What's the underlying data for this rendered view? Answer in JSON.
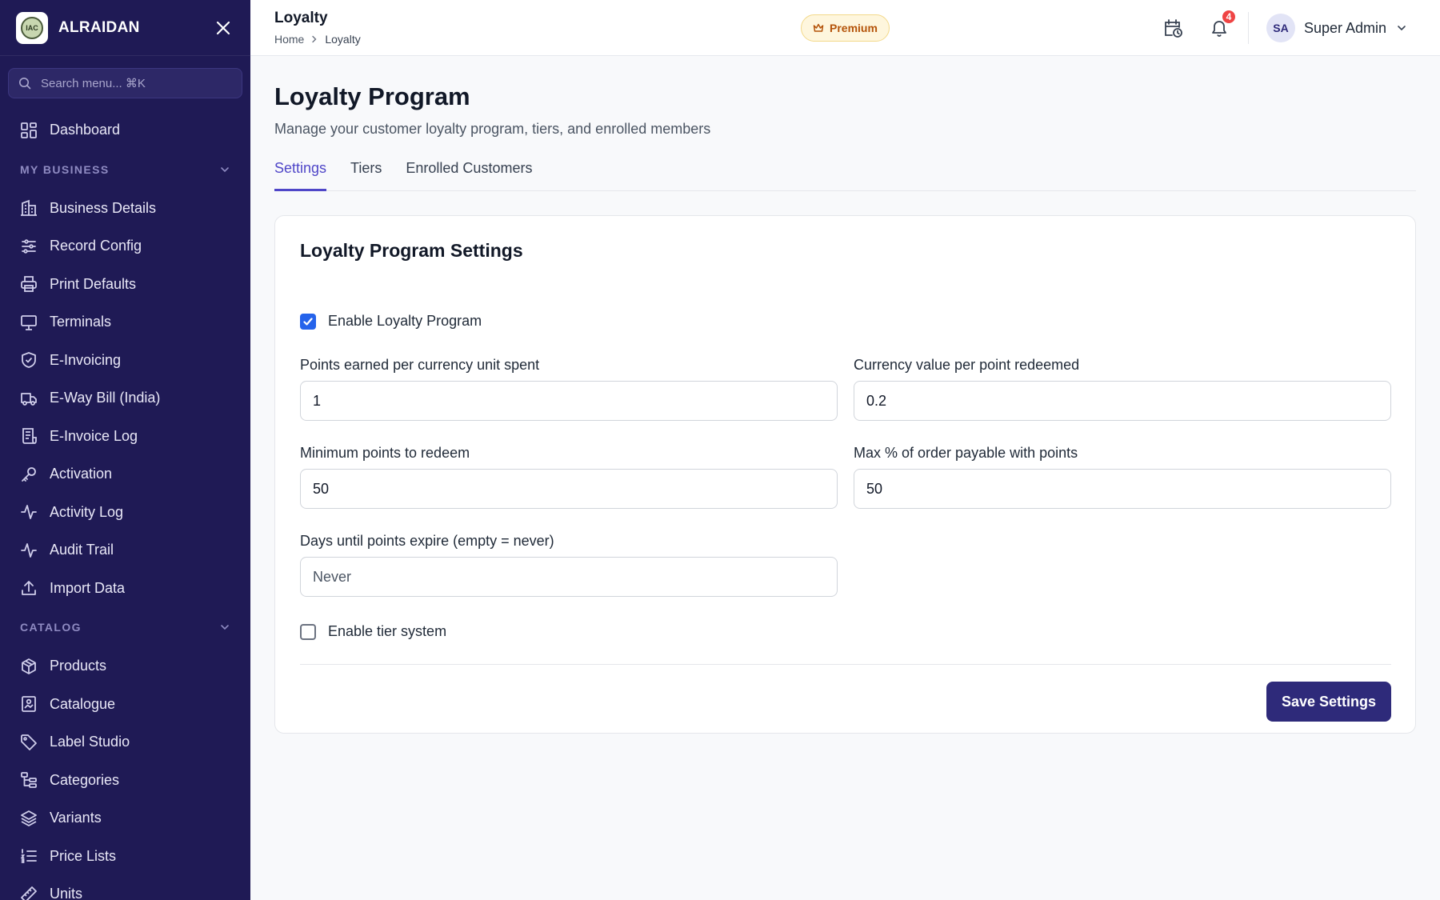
{
  "brand": {
    "name": "ALRAIDAN",
    "logo_text": "IAC"
  },
  "sidebar": {
    "search_placeholder": "Search menu... ⌘K",
    "top_items": [
      {
        "label": "Dashboard",
        "icon": "dashboard-icon"
      }
    ],
    "sections": [
      {
        "title": "MY BUSINESS",
        "items": [
          {
            "label": "Business Details",
            "icon": "building-icon"
          },
          {
            "label": "Record Config",
            "icon": "sliders-icon"
          },
          {
            "label": "Print Defaults",
            "icon": "printer-icon"
          },
          {
            "label": "Terminals",
            "icon": "monitor-icon"
          },
          {
            "label": "E-Invoicing",
            "icon": "shield-check-icon"
          },
          {
            "label": "E-Way Bill (India)",
            "icon": "truck-icon"
          },
          {
            "label": "E-Invoice Log",
            "icon": "receipt-icon"
          },
          {
            "label": "Activation",
            "icon": "key-icon"
          },
          {
            "label": "Activity Log",
            "icon": "activity-icon"
          },
          {
            "label": "Audit Trail",
            "icon": "activity-icon"
          },
          {
            "label": "Import Data",
            "icon": "upload-icon"
          }
        ]
      },
      {
        "title": "CATALOG",
        "items": [
          {
            "label": "Products",
            "icon": "package-icon"
          },
          {
            "label": "Catalogue",
            "icon": "image-book-icon"
          },
          {
            "label": "Label Studio",
            "icon": "tag-icon"
          },
          {
            "label": "Categories",
            "icon": "tree-icon"
          },
          {
            "label": "Variants",
            "icon": "layers-icon"
          },
          {
            "label": "Price Lists",
            "icon": "list-ordered-icon"
          },
          {
            "label": "Units",
            "icon": "ruler-icon"
          }
        ]
      }
    ]
  },
  "header": {
    "title": "Loyalty",
    "breadcrumb": [
      "Home",
      "Loyalty"
    ],
    "premium_label": "Premium",
    "notification_count": "4",
    "user": {
      "initials": "SA",
      "name": "Super Admin"
    }
  },
  "page": {
    "title": "Loyalty Program",
    "subtitle": "Manage your customer loyalty program, tiers, and enrolled members",
    "tabs": [
      "Settings",
      "Tiers",
      "Enrolled Customers"
    ],
    "active_tab": "Settings"
  },
  "settings": {
    "card_title": "Loyalty Program Settings",
    "enable_label": "Enable Loyalty Program",
    "enable_checked": true,
    "fields": {
      "points_per_unit": {
        "label": "Points earned per currency unit spent",
        "value": "1"
      },
      "currency_per_point": {
        "label": "Currency value per point redeemed",
        "value": "0.2"
      },
      "min_points": {
        "label": "Minimum points to redeem",
        "value": "50"
      },
      "max_percent": {
        "label": "Max % of order payable with points",
        "value": "50"
      },
      "expiry_days": {
        "label": "Days until points expire (empty = never)",
        "value": "",
        "placeholder": "Never"
      }
    },
    "tier_label": "Enable tier system",
    "tier_checked": false,
    "save_label": "Save Settings"
  },
  "colors": {
    "sidebar_bg": "#1f1a55",
    "accent": "#4f46c8",
    "primary_button": "#2e2a7a",
    "checkbox": "#2563eb",
    "badge": "#ef4444"
  }
}
